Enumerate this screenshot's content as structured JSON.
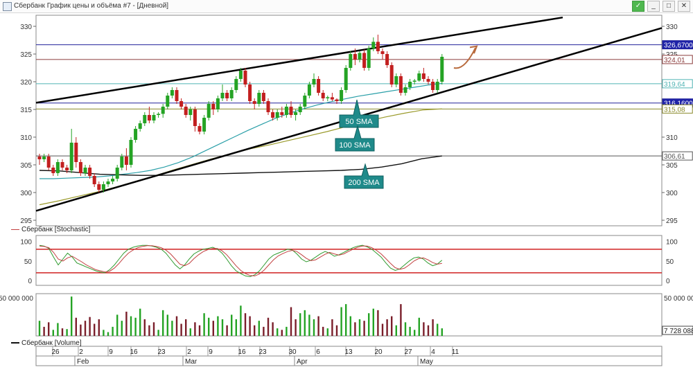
{
  "window": {
    "title": "Сбербанк График цены и объёма #7 - [Дневной]",
    "buttons": [
      "✓",
      "_",
      "□",
      "✕"
    ]
  },
  "chart_data": [
    {
      "type": "candlestick",
      "title": "",
      "ylim": [
        294,
        332
      ],
      "y_ticks": [
        295,
        300,
        305,
        310,
        315,
        320,
        325,
        330
      ],
      "x_ticks": [
        "26",
        "2",
        "9",
        "16",
        "23",
        "2",
        "9",
        "16",
        "23",
        "30",
        "6",
        "13",
        "20",
        "27",
        "4",
        "11"
      ],
      "x_months": [
        "Feb",
        "Mar",
        "Apr",
        "May"
      ],
      "candles": [
        [
          306.5,
          307,
          305,
          306
        ],
        [
          306,
          307,
          305.5,
          306.5
        ],
        [
          306.5,
          307,
          304,
          304.5
        ],
        [
          304.5,
          305,
          303,
          303.5
        ],
        [
          303.5,
          306,
          303,
          305.5
        ],
        [
          305.5,
          306,
          304,
          304.5
        ],
        [
          304.5,
          305,
          303.5,
          304
        ],
        [
          304,
          311.5,
          303.5,
          309
        ],
        [
          309,
          310,
          304.5,
          305.5
        ],
        [
          305.5,
          306,
          303,
          303.5
        ],
        [
          303.5,
          305,
          303,
          304.5
        ],
        [
          304.5,
          305,
          302.5,
          303
        ],
        [
          303,
          303.5,
          301,
          301.5
        ],
        [
          301.5,
          302,
          300,
          300.5
        ],
        [
          300.5,
          302,
          300,
          301.5
        ],
        [
          301.5,
          302.5,
          301,
          302
        ],
        [
          302,
          303,
          301.5,
          302.5
        ],
        [
          302.5,
          305,
          302,
          304.5
        ],
        [
          304.5,
          307,
          304,
          306.5
        ],
        [
          306.5,
          308,
          304,
          305
        ],
        [
          305,
          310,
          304.5,
          309.5
        ],
        [
          309.5,
          312,
          309,
          311.5
        ],
        [
          311.5,
          313,
          311,
          312.5
        ],
        [
          312.5,
          314.5,
          312,
          314
        ],
        [
          314,
          315.5,
          312.5,
          313
        ],
        [
          313,
          314.5,
          312.5,
          314
        ],
        [
          314,
          314.5,
          313.5,
          314.2
        ],
        [
          314.2,
          316,
          313.5,
          315.5
        ],
        [
          315.5,
          318,
          315,
          317.5
        ],
        [
          317.5,
          319,
          317,
          318.5
        ],
        [
          318.5,
          319,
          316,
          316.5
        ],
        [
          316.5,
          317,
          315,
          315.5
        ],
        [
          315.5,
          316,
          313.5,
          314
        ],
        [
          314,
          315.5,
          313,
          315
        ],
        [
          315,
          315.5,
          311,
          312
        ],
        [
          312,
          312.5,
          310.5,
          311
        ],
        [
          311,
          314,
          310.5,
          313.5
        ],
        [
          313.5,
          316.5,
          313,
          316
        ],
        [
          316,
          316.5,
          314,
          315
        ],
        [
          315,
          317.5,
          314.5,
          317
        ],
        [
          317,
          319.5,
          316.5,
          318
        ],
        [
          318,
          318.5,
          316.5,
          317
        ],
        [
          317,
          319,
          316.5,
          318.5
        ],
        [
          318.5,
          321,
          318,
          320.5
        ],
        [
          320.5,
          322.5,
          320,
          322
        ],
        [
          322,
          322.5,
          319,
          319.5
        ],
        [
          319.5,
          320,
          316,
          316.5
        ],
        [
          316.5,
          317,
          315,
          316
        ],
        [
          316,
          318.5,
          315.5,
          318
        ],
        [
          318,
          318.5,
          316,
          316.5
        ],
        [
          316.5,
          317,
          314,
          314.5
        ],
        [
          314.5,
          315,
          313,
          313.5
        ],
        [
          313.5,
          315,
          313,
          314.5
        ],
        [
          314.5,
          315.5,
          313.5,
          314
        ],
        [
          314,
          316,
          313.5,
          315.5
        ],
        [
          315.5,
          316.5,
          313.5,
          314
        ],
        [
          314,
          315,
          313,
          314.5
        ],
        [
          314.5,
          316,
          314,
          315.5
        ],
        [
          315.5,
          318,
          315,
          317.5
        ],
        [
          317.5,
          320,
          317,
          319.5
        ],
        [
          319.5,
          321.5,
          319,
          320.5
        ],
        [
          320.5,
          321,
          317.5,
          318
        ],
        [
          318,
          318.5,
          316.5,
          317
        ],
        [
          317,
          317.5,
          316.5,
          317.2
        ],
        [
          317.2,
          318,
          316.5,
          316.8
        ],
        [
          316.8,
          317,
          316,
          316.5
        ],
        [
          316.5,
          319,
          316,
          318.5
        ],
        [
          318.5,
          323,
          318,
          322.5
        ],
        [
          322.5,
          325.5,
          322,
          325
        ],
        [
          325,
          326,
          323,
          324
        ],
        [
          324,
          325.5,
          323.5,
          325.2
        ],
        [
          325.2,
          325.8,
          322,
          322.5
        ],
        [
          322.5,
          326.5,
          322,
          326
        ],
        [
          326,
          328,
          325.5,
          327.2
        ],
        [
          327.2,
          328.5,
          325,
          325.5
        ],
        [
          325.5,
          326,
          324,
          325
        ],
        [
          325,
          325.5,
          322.5,
          323
        ],
        [
          323,
          323.5,
          319,
          319.5
        ],
        [
          319.5,
          321.5,
          319,
          321
        ],
        [
          321,
          321.5,
          317.5,
          318
        ],
        [
          318,
          319.5,
          317.5,
          319
        ],
        [
          319,
          320.5,
          318.5,
          320
        ],
        [
          320,
          320.5,
          319.5,
          320.2
        ],
        [
          320.2,
          322,
          320,
          321.5
        ],
        [
          321.5,
          322.5,
          320,
          320.5
        ],
        [
          320.5,
          321,
          319.5,
          320
        ],
        [
          320,
          320.5,
          318,
          318.5
        ],
        [
          318.5,
          320.5,
          318,
          320
        ],
        [
          320,
          325,
          319.5,
          324.5
        ]
      ],
      "series": [
        {
          "name": "50 SMA",
          "values": [
            302.5,
            302.5,
            302.6,
            302.7,
            302.8,
            303,
            303.3,
            303.6,
            304,
            304.6,
            305.4,
            306.4,
            307.6,
            308.8,
            310,
            311.2,
            312.3,
            313.4,
            314.3,
            315.1,
            315.8,
            316.4,
            316.9,
            317.4,
            317.8,
            318.2,
            318.6,
            319,
            319.4,
            319.7
          ]
        },
        {
          "name": "100 SMA",
          "values": [
            297.8,
            298.5,
            299.3,
            300.1,
            301,
            302,
            303,
            304.1,
            305.1,
            306.1,
            307,
            307.9,
            308.6,
            309.4,
            310.2,
            311,
            311.9,
            312.8,
            313.6,
            314.3,
            314.9,
            315.1
          ]
        },
        {
          "name": "200 SMA",
          "values": [
            304,
            303.9,
            303.6,
            303.3,
            303.2,
            303.1,
            303.1,
            303.2,
            303.3,
            303.4,
            303.5,
            303.6,
            303.7,
            303.8,
            303.9,
            304,
            304.2,
            304.6,
            305.2,
            306.1,
            306.6
          ]
        }
      ],
      "horizontal_lines": [
        {
          "label": "326,67000",
          "value": 326.67,
          "color": "#20209a"
        },
        {
          "label": "324,01",
          "value": 324.01,
          "color": "#8b3b3b"
        },
        {
          "label": "319,64",
          "value": 319.64,
          "color": "#4fb3b3"
        },
        {
          "label": "316,16000",
          "value": 316.16,
          "color": "#20209a"
        },
        {
          "label": "315,08",
          "value": 315.08,
          "color": "#8a8a2a"
        },
        {
          "label": "306,61",
          "value": 306.61,
          "color": "#555555"
        }
      ],
      "annotations": [
        "50 SMA",
        "100 SMA",
        "200 SMA"
      ],
      "colors": {
        "up": "#24a324",
        "down": "#c21f1f",
        "sma50": "#2a9fa8",
        "sma100": "#9a9a2a",
        "sma200": "#111111",
        "trend": "#000000"
      }
    },
    {
      "type": "line",
      "legend": "Сбербанк [Stochastic]",
      "ylim": [
        -12,
        115
      ],
      "y_ticks": [
        100,
        50,
        0
      ],
      "levels": [
        80,
        20
      ],
      "series": [
        {
          "name": "%K",
          "color": "#2e9a2e",
          "values": [
            90,
            88,
            82,
            60,
            40,
            55,
            70,
            60,
            45,
            40,
            35,
            30,
            25,
            22,
            20,
            28,
            40,
            55,
            70,
            80,
            85,
            88,
            90,
            90,
            88,
            85,
            80,
            70,
            55,
            40,
            30,
            40,
            55,
            68,
            75,
            80,
            82,
            85,
            80,
            70,
            55,
            38,
            25,
            18,
            12,
            10,
            15,
            25,
            40,
            55,
            65,
            70,
            75,
            80,
            78,
            68,
            55,
            48,
            52,
            60,
            68,
            74,
            70,
            62,
            66,
            72,
            78,
            84,
            88,
            90,
            86,
            80,
            70,
            60,
            45,
            32,
            26,
            30,
            40,
            50,
            58,
            60,
            55,
            45,
            38,
            42,
            52
          ]
        },
        {
          "name": "%D",
          "color": "#c24040",
          "values": [
            88,
            87,
            84,
            72,
            55,
            50,
            58,
            62,
            55,
            48,
            40,
            34,
            28,
            25,
            22,
            24,
            32,
            44,
            58,
            70,
            78,
            84,
            87,
            89,
            89,
            87,
            84,
            78,
            68,
            55,
            42,
            38,
            44,
            56,
            66,
            74,
            79,
            82,
            82,
            76,
            66,
            52,
            38,
            26,
            18,
            13,
            12,
            17,
            27,
            40,
            53,
            63,
            69,
            74,
            77,
            74,
            66,
            57,
            51,
            53,
            60,
            67,
            72,
            68,
            65,
            68,
            74,
            80,
            85,
            88,
            88,
            84,
            77,
            68,
            56,
            44,
            33,
            29,
            32,
            40,
            50,
            56,
            58,
            53,
            46,
            42,
            44
          ]
        }
      ]
    },
    {
      "type": "bar",
      "legend": "Сбербанк [Volume]",
      "y_ticks": [
        "50 000 000",
        "7 728 088"
      ],
      "up_color": "#24a324",
      "down_color": "#7a1e2a",
      "values": [
        {
          "v": 20,
          "up": 1
        },
        {
          "v": 12,
          "up": 0
        },
        {
          "v": 18,
          "up": 0
        },
        {
          "v": 8,
          "up": 1
        },
        {
          "v": 17,
          "up": 1
        },
        {
          "v": 10,
          "up": 0
        },
        {
          "v": 9,
          "up": 1
        },
        {
          "v": 52,
          "up": 1
        },
        {
          "v": 24,
          "up": 0
        },
        {
          "v": 15,
          "up": 0
        },
        {
          "v": 20,
          "up": 0
        },
        {
          "v": 25,
          "up": 0
        },
        {
          "v": 16,
          "up": 0
        },
        {
          "v": 22,
          "up": 0
        },
        {
          "v": 8,
          "up": 1
        },
        {
          "v": 5,
          "up": 1
        },
        {
          "v": 12,
          "up": 1
        },
        {
          "v": 28,
          "up": 1
        },
        {
          "v": 20,
          "up": 1
        },
        {
          "v": 32,
          "up": 0
        },
        {
          "v": 26,
          "up": 1
        },
        {
          "v": 24,
          "up": 1
        },
        {
          "v": 36,
          "up": 1
        },
        {
          "v": 22,
          "up": 0
        },
        {
          "v": 14,
          "up": 0
        },
        {
          "v": 18,
          "up": 0
        },
        {
          "v": 8,
          "up": 1
        },
        {
          "v": 34,
          "up": 1
        },
        {
          "v": 28,
          "up": 1
        },
        {
          "v": 20,
          "up": 1
        },
        {
          "v": 26,
          "up": 0
        },
        {
          "v": 16,
          "up": 0
        },
        {
          "v": 22,
          "up": 0
        },
        {
          "v": 10,
          "up": 1
        },
        {
          "v": 18,
          "up": 0
        },
        {
          "v": 14,
          "up": 0
        },
        {
          "v": 30,
          "up": 1
        },
        {
          "v": 24,
          "up": 1
        },
        {
          "v": 20,
          "up": 0
        },
        {
          "v": 26,
          "up": 1
        },
        {
          "v": 22,
          "up": 1
        },
        {
          "v": 14,
          "up": 0
        },
        {
          "v": 28,
          "up": 1
        },
        {
          "v": 22,
          "up": 1
        },
        {
          "v": 40,
          "up": 1
        },
        {
          "v": 30,
          "up": 0
        },
        {
          "v": 26,
          "up": 0
        },
        {
          "v": 14,
          "up": 0
        },
        {
          "v": 20,
          "up": 1
        },
        {
          "v": 12,
          "up": 0
        },
        {
          "v": 24,
          "up": 0
        },
        {
          "v": 18,
          "up": 0
        },
        {
          "v": 10,
          "up": 1
        },
        {
          "v": 8,
          "up": 0
        },
        {
          "v": 12,
          "up": 1
        },
        {
          "v": 38,
          "up": 0
        },
        {
          "v": 22,
          "up": 0
        },
        {
          "v": 30,
          "up": 1
        },
        {
          "v": 34,
          "up": 1
        },
        {
          "v": 28,
          "up": 1
        },
        {
          "v": 22,
          "up": 1
        },
        {
          "v": 26,
          "up": 0
        },
        {
          "v": 12,
          "up": 0
        },
        {
          "v": 10,
          "up": 1
        },
        {
          "v": 22,
          "up": 0
        },
        {
          "v": 14,
          "up": 0
        },
        {
          "v": 38,
          "up": 1
        },
        {
          "v": 42,
          "up": 1
        },
        {
          "v": 26,
          "up": 1
        },
        {
          "v": 18,
          "up": 0
        },
        {
          "v": 22,
          "up": 1
        },
        {
          "v": 20,
          "up": 0
        },
        {
          "v": 30,
          "up": 1
        },
        {
          "v": 36,
          "up": 1
        },
        {
          "v": 34,
          "up": 0
        },
        {
          "v": 16,
          "up": 0
        },
        {
          "v": 22,
          "up": 0
        },
        {
          "v": 26,
          "up": 0
        },
        {
          "v": 14,
          "up": 1
        },
        {
          "v": 42,
          "up": 0
        },
        {
          "v": 18,
          "up": 1
        },
        {
          "v": 12,
          "up": 1
        },
        {
          "v": 8,
          "up": 1
        },
        {
          "v": 24,
          "up": 1
        },
        {
          "v": 18,
          "up": 0
        },
        {
          "v": 14,
          "up": 0
        },
        {
          "v": 22,
          "up": 0
        },
        {
          "v": 16,
          "up": 1
        },
        {
          "v": 10,
          "up": 1
        }
      ]
    }
  ]
}
